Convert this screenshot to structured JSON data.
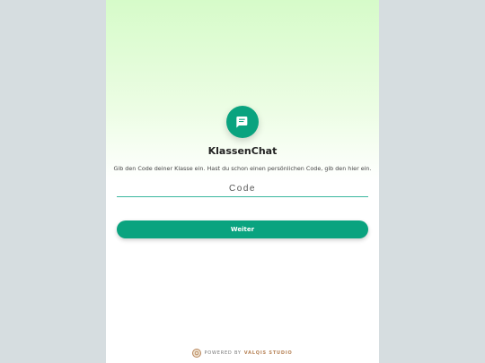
{
  "app": {
    "title": "KlassenChat",
    "subtitle": "Gib den Code deiner Klasse ein. Hast du schon einen persönlichen Code, gib den hier ein.",
    "logo_icon": "chat-bubble-icon",
    "accent_color": "#0aa37f"
  },
  "form": {
    "code_placeholder": "Code",
    "code_value": "",
    "submit_label": "Weiter"
  },
  "footer": {
    "powered_by": "POWERED BY",
    "studio": "VALQIS STUDIO",
    "logo_icon": "studio-logo-icon"
  }
}
